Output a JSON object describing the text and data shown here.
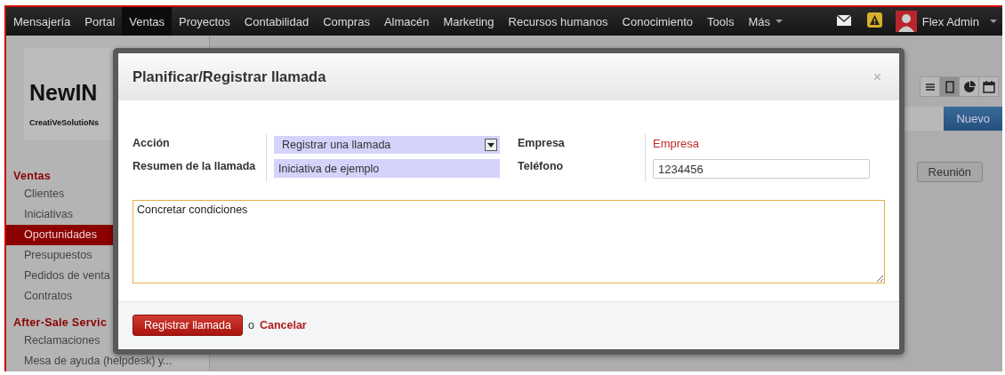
{
  "nav": {
    "items": [
      {
        "label": "Mensajería",
        "selected": false
      },
      {
        "label": "Portal",
        "selected": false
      },
      {
        "label": "Ventas",
        "selected": true
      },
      {
        "label": "Proyectos",
        "selected": false
      },
      {
        "label": "Contabilidad",
        "selected": false
      },
      {
        "label": "Compras",
        "selected": false
      },
      {
        "label": "Almacén",
        "selected": false
      },
      {
        "label": "Marketing",
        "selected": false
      },
      {
        "label": "Recursos humanos",
        "selected": false
      },
      {
        "label": "Conocimiento",
        "selected": false
      },
      {
        "label": "Tools",
        "selected": false
      }
    ],
    "more": "Más",
    "user": "Flex Admin"
  },
  "sidebar": {
    "logo": "NewIN",
    "company": "CreatiVeSolutioNs",
    "sections": [
      {
        "title": "Ventas",
        "items": [
          {
            "label": "Clientes",
            "selected": false
          },
          {
            "label": "Iniciativas",
            "selected": false
          },
          {
            "label": "Oportunidades",
            "selected": true
          },
          {
            "label": "Presupuestos",
            "selected": false
          },
          {
            "label": "Pedidos de venta",
            "selected": false
          },
          {
            "label": "Contratos",
            "selected": false
          }
        ]
      },
      {
        "title": "After-Sale Servic",
        "items": [
          {
            "label": "Reclamaciones",
            "selected": false
          },
          {
            "label": "Mesa de ayuda (helpdesk) y...",
            "selected": false
          }
        ]
      }
    ]
  },
  "main": {
    "views": [
      {
        "kind": "list",
        "selected": false
      },
      {
        "kind": "form",
        "selected": true
      },
      {
        "kind": "graph",
        "selected": false
      },
      {
        "kind": "calendar",
        "selected": false
      }
    ],
    "create_button": "Nuevo",
    "buttons": [
      "Reunión"
    ]
  },
  "dialog": {
    "title": "Planificar/Registrar llamada",
    "close": "×",
    "left_fields": [
      {
        "label": "Acción",
        "kind": "select",
        "value": "Registrar una llamada"
      },
      {
        "label": "Resumen de la llamada",
        "kind": "text",
        "value": "Iniciativa de ejemplo"
      }
    ],
    "right_fields": [
      {
        "label": "Empresa",
        "kind": "link",
        "value": "Empresa"
      },
      {
        "label": "Teléfono",
        "kind": "text",
        "value": "1234456"
      }
    ],
    "notes": "Concretar condiciones",
    "submit": "Registrar llamada",
    "separator": "o",
    "cancel": "Cancelar"
  }
}
